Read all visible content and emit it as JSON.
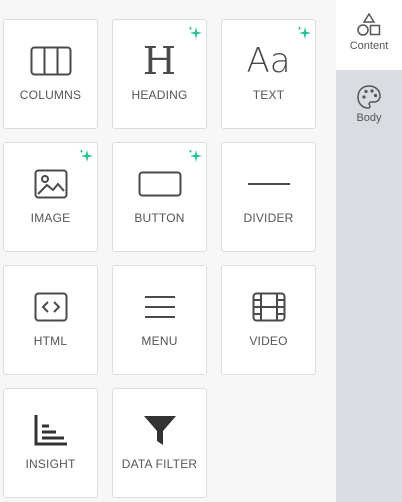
{
  "blocks": [
    {
      "label": "COLUMNS",
      "icon": "columns-icon",
      "ai": false
    },
    {
      "label": "HEADING",
      "icon": "heading-icon",
      "ai": true
    },
    {
      "label": "TEXT",
      "icon": "text-icon",
      "ai": true
    },
    {
      "label": "IMAGE",
      "icon": "image-icon",
      "ai": true
    },
    {
      "label": "BUTTON",
      "icon": "button-icon",
      "ai": true
    },
    {
      "label": "DIVIDER",
      "icon": "divider-icon",
      "ai": false
    },
    {
      "label": "HTML",
      "icon": "code-icon",
      "ai": false
    },
    {
      "label": "MENU",
      "icon": "menu-icon",
      "ai": false
    },
    {
      "label": "VIDEO",
      "icon": "video-icon",
      "ai": false
    },
    {
      "label": "INSIGHT",
      "icon": "bar-chart-icon",
      "ai": false
    },
    {
      "label": "DATA FILTER",
      "icon": "funnel-icon",
      "ai": false
    }
  ],
  "heading_glyph": "H",
  "text_glyph": "Aa",
  "sidebar": {
    "tabs": [
      {
        "label": "Content",
        "icon": "shapes-icon",
        "active": true
      },
      {
        "label": "Body",
        "icon": "palette-icon",
        "active": false
      }
    ]
  },
  "colors": {
    "sparkle": "#2bbf9a",
    "icon": "#4a4a4a",
    "sidebar_bg": "#d9dce0"
  }
}
